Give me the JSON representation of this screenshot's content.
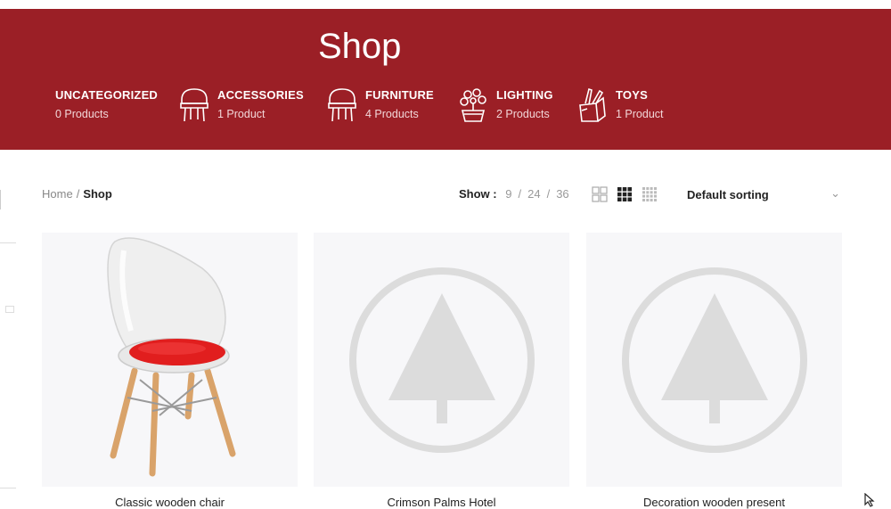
{
  "hero": {
    "title": "Shop",
    "categories": [
      {
        "name": "UNCATEGORIZED",
        "count": "0 Products",
        "icon": "none"
      },
      {
        "name": "ACCESSORIES",
        "count": "1 Product",
        "icon": "chair-icon"
      },
      {
        "name": "FURNITURE",
        "count": "4 Products",
        "icon": "chair-icon"
      },
      {
        "name": "LIGHTING",
        "count": "2 Products",
        "icon": "plant-icon"
      },
      {
        "name": "TOYS",
        "count": "1 Product",
        "icon": "toys-icon"
      }
    ],
    "background": "#9b1f26"
  },
  "breadcrumb": {
    "home": "Home",
    "separator": "/",
    "current": "Shop"
  },
  "toolbar": {
    "show_label": "Show :",
    "show_options": [
      "9",
      "24",
      "36"
    ],
    "separator": "/",
    "sort_label": "Default sorting"
  },
  "products": [
    {
      "title": "Classic wooden chair",
      "image": "chair-photo"
    },
    {
      "title": "Crimson Palms Hotel",
      "image": "placeholder-tree"
    },
    {
      "title": "Decoration wooden present",
      "image": "placeholder-tree"
    }
  ]
}
